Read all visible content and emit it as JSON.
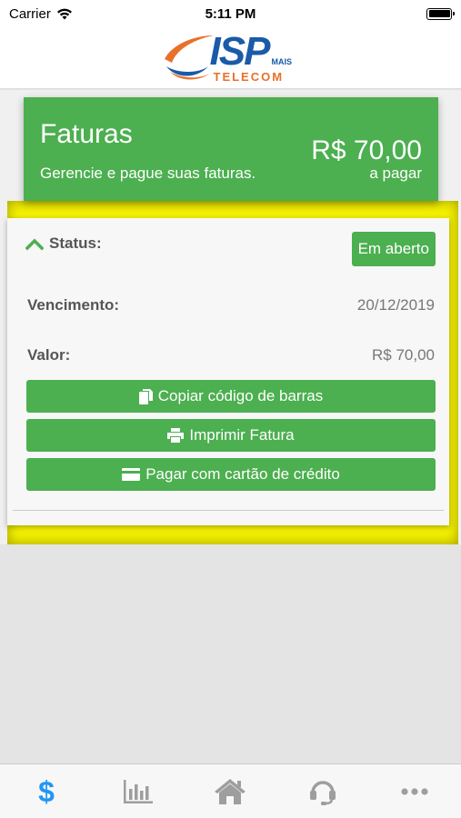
{
  "status_bar": {
    "carrier": "Carrier",
    "time": "5:11 PM"
  },
  "header": {
    "logo_isp": "ISP",
    "logo_mais": "MAIS",
    "logo_telecom": "TELECOM"
  },
  "banner": {
    "title": "Faturas",
    "subtitle": "Gerencie e pague suas faturas.",
    "amount": "R$ 70,00",
    "amount_caption": "a pagar"
  },
  "invoice": {
    "status_label": "Status:",
    "status_value": "Em aberto",
    "due_label": "Vencimento:",
    "due_value": "20/12/2019",
    "value_label": "Valor:",
    "value_value": "R$ 70,00"
  },
  "actions": {
    "copy_barcode": "Copiar código de barras",
    "print_invoice": "Imprimir Fatura",
    "pay_card": "Pagar com cartão de crédito"
  },
  "tab_bar": {
    "items": [
      {
        "icon": "dollar-icon",
        "active": true
      },
      {
        "icon": "bar-chart-icon",
        "active": false
      },
      {
        "icon": "home-icon",
        "active": false
      },
      {
        "icon": "headset-icon",
        "active": false
      },
      {
        "icon": "more-icon",
        "active": false
      }
    ],
    "active_color": "#2196f3",
    "inactive_color": "#9e9e9e"
  },
  "colors": {
    "green": "#4caf50",
    "yellow": "#f4f000",
    "logo_blue": "#1a5aa8",
    "logo_orange": "#e8712a"
  }
}
